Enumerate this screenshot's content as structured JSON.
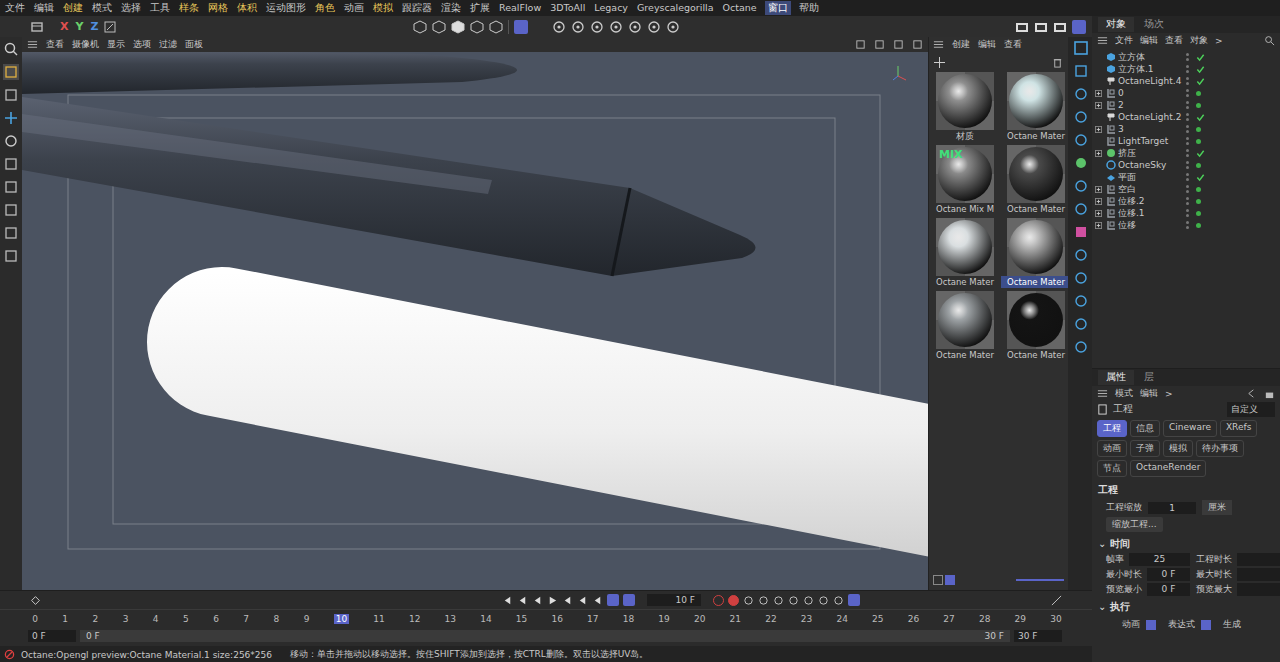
{
  "menu": [
    {
      "label": "文件",
      "accent": false,
      "highlighted": false
    },
    {
      "label": "编辑",
      "accent": false,
      "highlighted": false
    },
    {
      "label": "创建",
      "accent": true,
      "highlighted": false
    },
    {
      "label": "模式",
      "accent": false,
      "highlighted": false
    },
    {
      "label": "选择",
      "accent": false,
      "highlighted": false
    },
    {
      "label": "工具",
      "accent": false,
      "highlighted": false
    },
    {
      "label": "样条",
      "accent": true,
      "highlighted": false
    },
    {
      "label": "网格",
      "accent": true,
      "highlighted": false
    },
    {
      "label": "体积",
      "accent": true,
      "highlighted": false
    },
    {
      "label": "运动图形",
      "accent": false,
      "highlighted": false
    },
    {
      "label": "角色",
      "accent": true,
      "highlighted": false
    },
    {
      "label": "动画",
      "accent": false,
      "highlighted": false
    },
    {
      "label": "模拟",
      "accent": true,
      "highlighted": false
    },
    {
      "label": "跟踪器",
      "accent": false,
      "highlighted": false
    },
    {
      "label": "渲染",
      "accent": false,
      "highlighted": false
    },
    {
      "label": "扩展",
      "accent": false,
      "highlighted": false
    },
    {
      "label": "RealFlow",
      "accent": false,
      "highlighted": false
    },
    {
      "label": "3DToAll",
      "accent": false,
      "highlighted": false
    },
    {
      "label": "Legacy",
      "accent": false,
      "highlighted": false
    },
    {
      "label": "Greyscalegorilla",
      "accent": false,
      "highlighted": false
    },
    {
      "label": "Octane",
      "accent": false,
      "highlighted": false
    },
    {
      "label": "窗口",
      "accent": false,
      "highlighted": true
    },
    {
      "label": "帮助",
      "accent": false,
      "highlighted": false
    }
  ],
  "toolbar": {
    "axes": [
      "X",
      "Y",
      "Z"
    ]
  },
  "viewport": {
    "menu": [
      "查看",
      "摄像机",
      "显示",
      "选项",
      "过滤",
      "面板"
    ]
  },
  "materials": {
    "menu": [
      "创建",
      "编辑",
      "查看"
    ],
    "items": [
      {
        "label": "材质",
        "selected": false,
        "color": "#8f8f8f",
        "badge": ""
      },
      {
        "label": "Octane Mater",
        "selected": false,
        "color": "#cfe3e4",
        "badge": ""
      },
      {
        "label": "Octane Mix M",
        "selected": false,
        "color": "#8a8a8a",
        "badge": "MIX"
      },
      {
        "label": "Octane Mater",
        "selected": false,
        "color": "#4a4a4a",
        "badge": ""
      },
      {
        "label": "Octane Mater",
        "selected": false,
        "color": "#d9dee0",
        "badge": ""
      },
      {
        "label": "Octane Mater",
        "selected": true,
        "color": "#b8b8b8",
        "badge": ""
      },
      {
        "label": "Octane Mater",
        "selected": false,
        "color": "#9ea3a6",
        "badge": ""
      },
      {
        "label": "Octane Mater",
        "selected": false,
        "color": "#141414",
        "badge": ""
      }
    ]
  },
  "objects": {
    "tabs": [
      {
        "label": "对象",
        "selected": true
      },
      {
        "label": "场次",
        "selected": false
      }
    ],
    "menu": [
      "文件",
      "编辑",
      "查看",
      "对象",
      ">"
    ],
    "rows": [
      {
        "name": "立方体",
        "kind": "cube",
        "expandable": false,
        "checked": true
      },
      {
        "name": "立方体.1",
        "kind": "cube",
        "expandable": false,
        "checked": true
      },
      {
        "name": "OctaneLight.4",
        "kind": "light",
        "expandable": false,
        "checked": true
      },
      {
        "name": "0",
        "kind": "null",
        "expandable": true,
        "checked": false
      },
      {
        "name": "2",
        "kind": "null",
        "expandable": true,
        "checked": false
      },
      {
        "name": "OctaneLight.2",
        "kind": "light",
        "expandable": false,
        "checked": true
      },
      {
        "name": "3",
        "kind": "null",
        "expandable": true,
        "checked": false
      },
      {
        "name": "LightTarget",
        "kind": "null",
        "expandable": false,
        "checked": false
      },
      {
        "name": "挤压",
        "kind": "extrude",
        "expandable": true,
        "checked": true
      },
      {
        "name": "OctaneSky",
        "kind": "sky",
        "expandable": false,
        "checked": false
      },
      {
        "name": "平面",
        "kind": "plane",
        "expandable": false,
        "checked": true
      },
      {
        "name": "空白",
        "kind": "null",
        "expandable": true,
        "checked": false
      },
      {
        "name": "位移.2",
        "kind": "null",
        "expandable": true,
        "checked": false
      },
      {
        "name": "位移.1",
        "kind": "null",
        "expandable": true,
        "checked": false
      },
      {
        "name": "位移",
        "kind": "null",
        "expandable": true,
        "checked": false
      }
    ]
  },
  "attributes": {
    "tabs": [
      {
        "label": "属性",
        "selected": true
      },
      {
        "label": "层",
        "selected": false
      }
    ],
    "menu": [
      "模式",
      "编辑",
      ">"
    ],
    "title": "工程",
    "preset": "自定义",
    "pages": [
      {
        "label": "工程",
        "selected": true
      },
      {
        "label": "信息",
        "selected": false
      },
      {
        "label": "Cineware",
        "selected": false
      },
      {
        "label": "XRefs",
        "selected": false
      },
      {
        "label": "动画",
        "selected": false
      },
      {
        "label": "子弹",
        "selected": false
      },
      {
        "label": "模拟",
        "selected": false
      },
      {
        "label": "待办事项",
        "selected": false
      },
      {
        "label": "节点",
        "selected": false
      },
      {
        "label": "OctaneRender",
        "selected": false
      }
    ],
    "project_section": "工程",
    "scale_label": "工程缩放",
    "scale_value": "1",
    "scale_unit": "厘米",
    "scale_button": "缩放工程...",
    "time_section": "时间",
    "time_fields": [
      {
        "label": "帧率",
        "value": "25"
      },
      {
        "label": "工程时长",
        "value": ""
      },
      {
        "label": "最小时长",
        "value": "0 F"
      },
      {
        "label": "最大时长",
        "value": ""
      },
      {
        "label": "预览最小",
        "value": "0 F"
      },
      {
        "label": "预览最大",
        "value": ""
      }
    ],
    "exec_section": "执行",
    "exec_options": [
      {
        "label": "动画",
        "checked": true
      },
      {
        "label": "表达式",
        "checked": true
      },
      {
        "label": "生成",
        "checked": false
      }
    ]
  },
  "timeline": {
    "frame": "10 F",
    "ticks": [
      {
        "label": "0",
        "selected": false
      },
      {
        "label": "1",
        "selected": false
      },
      {
        "label": "2",
        "selected": false
      },
      {
        "label": "3",
        "selected": false
      },
      {
        "label": "4",
        "selected": false
      },
      {
        "label": "5",
        "selected": false
      },
      {
        "label": "6",
        "selected": false
      },
      {
        "label": "7",
        "selected": false
      },
      {
        "label": "8",
        "selected": false
      },
      {
        "label": "9",
        "selected": false
      },
      {
        "label": "10",
        "selected": true
      },
      {
        "label": "11",
        "selected": false
      },
      {
        "label": "12",
        "selected": false
      },
      {
        "label": "13",
        "selected": false
      },
      {
        "label": "14",
        "selected": false
      },
      {
        "label": "15",
        "selected": false
      },
      {
        "label": "16",
        "selected": false
      },
      {
        "label": "17",
        "selected": false
      },
      {
        "label": "18",
        "selected": false
      },
      {
        "label": "19",
        "selected": false
      },
      {
        "label": "20",
        "selected": false
      },
      {
        "label": "21",
        "selected": false
      },
      {
        "label": "22",
        "selected": false
      },
      {
        "label": "23",
        "selected": false
      },
      {
        "label": "24",
        "selected": false
      },
      {
        "label": "25",
        "selected": false
      },
      {
        "label": "26",
        "selected": false
      },
      {
        "label": "27",
        "selected": false
      },
      {
        "label": "28",
        "selected": false
      },
      {
        "label": "29",
        "selected": false
      },
      {
        "label": "30",
        "selected": false
      }
    ],
    "start": "0 F",
    "preview_start": "0 F",
    "preview_end": "30 F",
    "end": "30 F"
  },
  "status": {
    "info": "Octane:Opengl preview:Octane Material.1  size:256*256",
    "hint": "移动：单击并拖动以移动选择。按住SHIFT添加到选择，按CTRL删除。双击以选择UV岛。"
  }
}
